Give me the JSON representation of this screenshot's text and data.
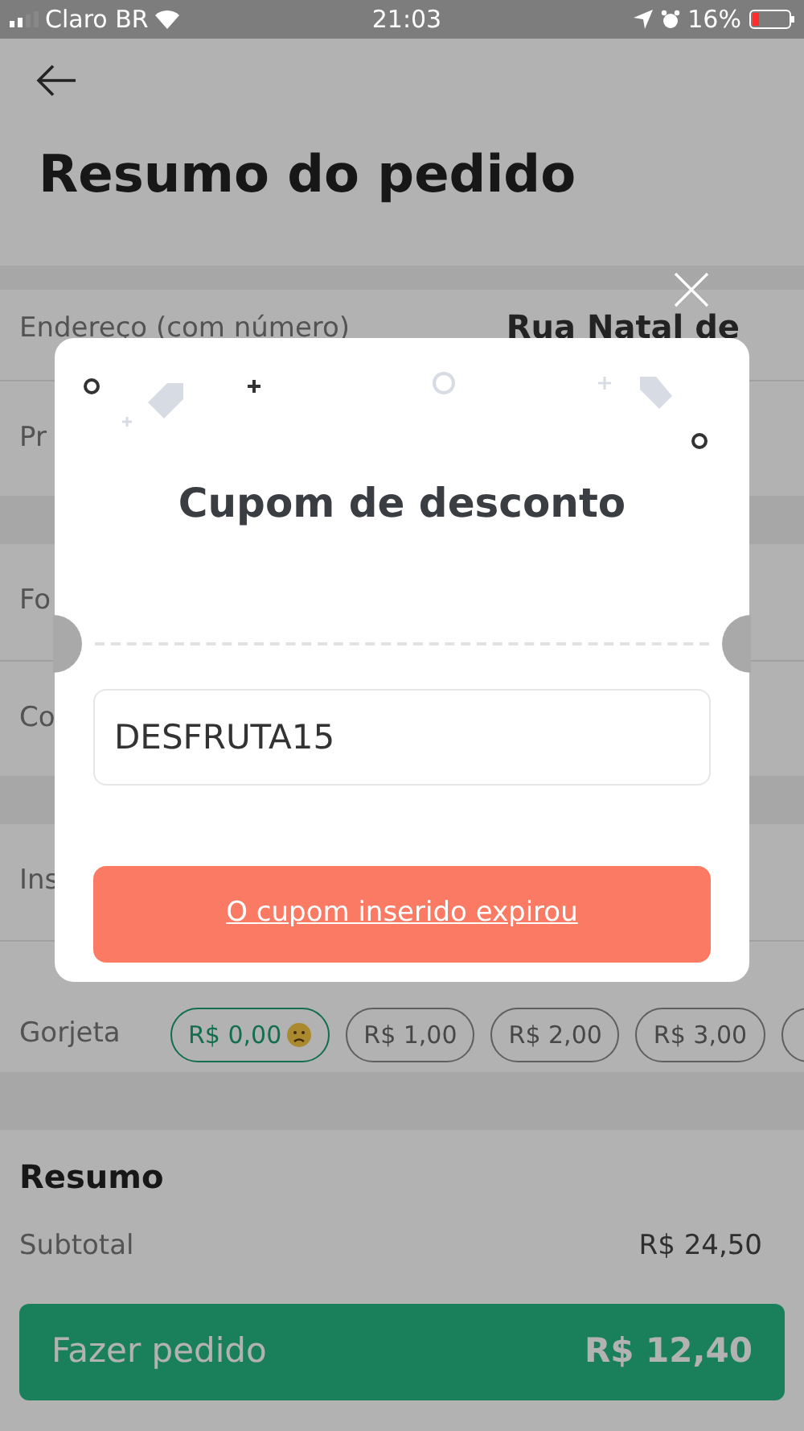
{
  "status_bar": {
    "carrier": "Claro BR",
    "time": "21:03",
    "battery": "16%"
  },
  "header": {
    "title": "Resumo do pedido"
  },
  "sections": [
    {
      "rows": [
        {
          "kind": "field",
          "label": "Endereço (com número)",
          "value": "Rua Natal de"
        },
        {
          "kind": "field",
          "label": "Pr"
        }
      ]
    },
    {
      "rows": [
        {
          "kind": "field",
          "label": "Fo"
        },
        {
          "kind": "field",
          "label": "Co"
        }
      ]
    },
    {
      "rows": [
        {
          "kind": "field",
          "label": "Ins"
        },
        {
          "kind": "tips",
          "label": "Gorjeta",
          "chips": [
            {
              "label": "R$ 0,00",
              "selected": true,
              "emoji": true
            },
            {
              "label": "R$ 1,00",
              "selected": false
            },
            {
              "label": "R$ 2,00",
              "selected": false
            },
            {
              "label": "R$ 3,00",
              "selected": false
            },
            {
              "selected": false
            }
          ]
        }
      ]
    }
  ],
  "summary": {
    "title": "Resumo",
    "lines": [
      {
        "label": "Subtotal",
        "value": "R$ 24,50"
      }
    ]
  },
  "order_button": {
    "label": "Fazer pedido",
    "total": "R$ 12,40"
  },
  "coupon_dialog": {
    "title": "Cupom de desconto",
    "code": "DESFRUTA15",
    "error": "O cupom inserido expirou"
  }
}
